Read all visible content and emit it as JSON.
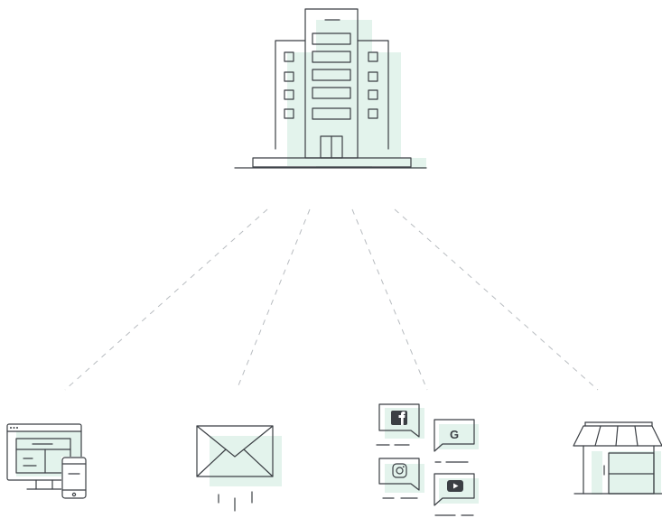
{
  "diagram": {
    "hub": {
      "icon": "office-building-icon"
    },
    "channels": [
      {
        "id": "web",
        "icon": "responsive-web-devices-icon"
      },
      {
        "id": "email",
        "icon": "email-envelope-icon"
      },
      {
        "id": "social",
        "icon": "social-media-channels-icon",
        "networks": [
          "facebook-icon",
          "google-icon",
          "instagram-icon",
          "youtube-icon"
        ]
      },
      {
        "id": "store",
        "icon": "retail-storefront-icon"
      }
    ],
    "connector_style": "dashed",
    "colors": {
      "line": "#3b3f44",
      "accent": "#e3f3ec",
      "connector": "#b8bcc0"
    }
  }
}
